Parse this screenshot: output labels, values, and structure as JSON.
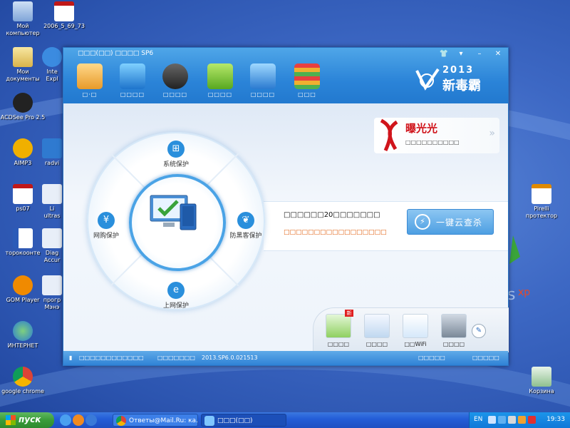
{
  "desktop": {
    "icons": [
      {
        "label": "Мой компьютер",
        "icon": "computer-icon"
      },
      {
        "label": "2006_5_69_73",
        "icon": "pdf-icon"
      },
      {
        "label": "Мои документы",
        "icon": "documents-icon"
      },
      {
        "label": "Inte Expl",
        "icon": "ie-icon"
      },
      {
        "label": "ACDSee Pro 2.5",
        "icon": "acdsee-icon"
      },
      {
        "label": "AIMP3",
        "icon": "aimp-icon"
      },
      {
        "label": "radvi",
        "icon": "folder-icon"
      },
      {
        "label": "ps07",
        "icon": "pdf-icon"
      },
      {
        "label": "Li ultras",
        "icon": "doc-icon"
      },
      {
        "label": "торокоонте",
        "icon": "word-icon"
      },
      {
        "label": "Diag Accur",
        "icon": "doc-icon"
      },
      {
        "label": "GOM Player",
        "icon": "gom-icon"
      },
      {
        "label": "прогр Мэнэ",
        "icon": "doc-icon"
      },
      {
        "label": "ИНТЕРНЕТ",
        "icon": "internet-icon"
      },
      {
        "label": "google chrome",
        "icon": "chrome-icon"
      },
      {
        "label": "Pirelli протектор",
        "icon": "pirelli-icon"
      },
      {
        "label": "Корзина",
        "icon": "recycle-bin-icon"
      }
    ]
  },
  "app": {
    "title": "□□□(□□) □□□□ SP6",
    "nav": [
      {
        "label": "□·□",
        "icon": "home-icon"
      },
      {
        "label": "□□□□",
        "icon": "monitor-bolt-icon"
      },
      {
        "label": "□□□□",
        "icon": "scan-icon"
      },
      {
        "label": "□□□□",
        "icon": "cart-shield-icon"
      },
      {
        "label": "□□□□",
        "icon": "toolbox-icon"
      },
      {
        "label": "□□□",
        "icon": "layers-icon"
      }
    ],
    "brand": {
      "year": "2013",
      "name": "新毒霸"
    },
    "promo": {
      "title": "曝光光",
      "subtitle": "□□□□□□□□□□"
    },
    "protections": {
      "system": "系统保护",
      "shopping": "网购保护",
      "hacker": "防黑客保护",
      "web": "上网保护",
      "center": "□□□□□□"
    },
    "status": {
      "text": "□□□□□□20□□□□□□□",
      "link": "□□□□□□□□□□□□□□□□□"
    },
    "cloud_button": "一键云查杀",
    "tools": [
      {
        "label": "□□□□",
        "icon": "cleanup-icon"
      },
      {
        "label": "□□□□",
        "icon": "doctor-icon"
      },
      {
        "label": "□□WiFi",
        "icon": "wifi-icon"
      },
      {
        "label": "□□□□",
        "icon": "pc-icon"
      }
    ],
    "statusbar": {
      "left": "□□□□□□□□□□□□",
      "mid": "□□□□□□□",
      "version": "2013.SP6.0.021513",
      "right1": "□□□□□",
      "right2": "□□□□□"
    }
  },
  "taskbar": {
    "start": "пуск",
    "tasks": [
      {
        "label": "Ответы@Mail.Ru: ка...",
        "icon": "chrome-icon"
      },
      {
        "label": "□□□(□□)",
        "icon": "duba-icon"
      }
    ],
    "tray": {
      "lang": "EN",
      "clock": "19:33"
    }
  }
}
